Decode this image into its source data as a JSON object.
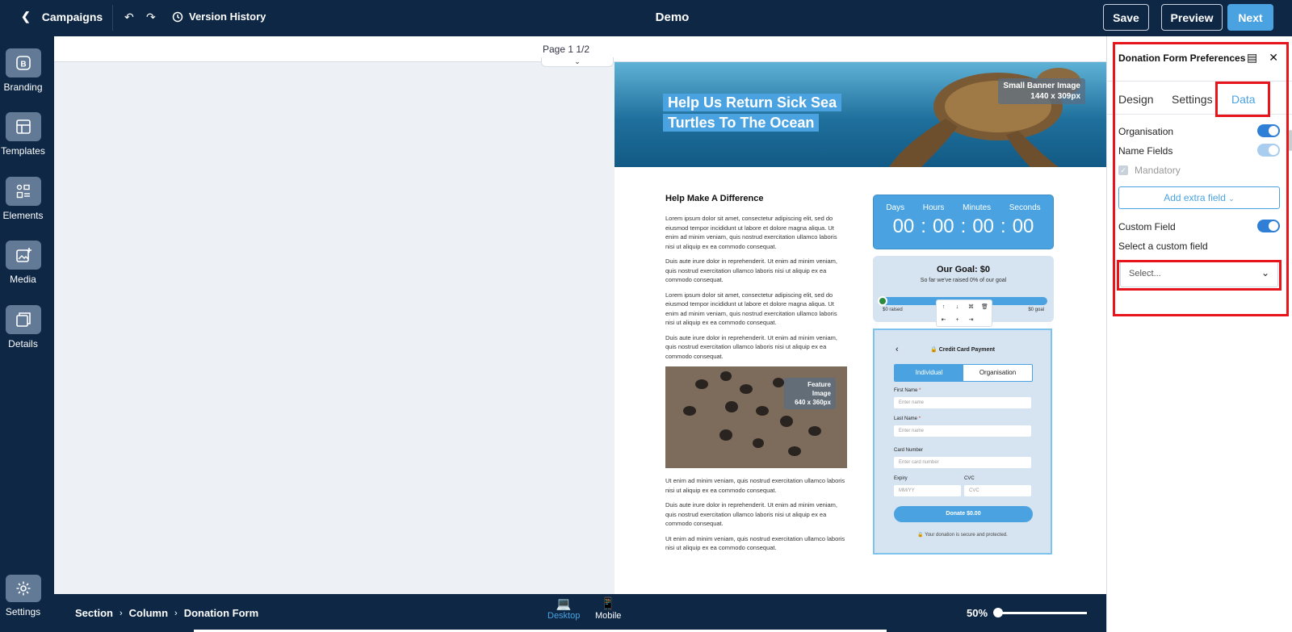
{
  "topbar": {
    "back_label": "Campaigns",
    "version_history": "Version History",
    "title": "Demo",
    "save": "Save",
    "preview": "Preview",
    "next": "Next"
  },
  "sidebar": {
    "items": [
      {
        "label": "Branding",
        "icon": "branding-icon"
      },
      {
        "label": "Templates",
        "icon": "templates-icon"
      },
      {
        "label": "Elements",
        "icon": "elements-icon"
      },
      {
        "label": "Media",
        "icon": "media-icon"
      },
      {
        "label": "Details",
        "icon": "details-icon"
      }
    ],
    "settings": "Settings"
  },
  "canvas": {
    "page_indicator": "Page 1 1/2",
    "banner_title": "Help Us Return Sick Sea Turtles To The Ocean",
    "banner_badge_line1": "Small Banner Image",
    "banner_badge_line2": "1440 x 309px",
    "heading": "Help Make A Difference",
    "paragraphs": [
      "Lorem ipsum dolor sit amet, consectetur adipiscing elit, sed do eiusmod tempor incididunt ut labore et dolore magna aliqua. Ut enim ad minim veniam, quis nostrud exercitation ullamco laboris nisi ut aliquip ex ea commodo consequat.",
      "Duis aute irure dolor in reprehenderit. Ut enim ad minim veniam, quis nostrud exercitation ullamco laboris nisi ut aliquip ex ea commodo consequat.",
      "Lorem ipsum dolor sit amet, consectetur adipiscing elit, sed do eiusmod tempor incididunt ut labore et dolore magna aliqua. Ut enim ad minim veniam, quis nostrud exercitation ullamco laboris nisi ut aliquip ex ea commodo consequat.",
      "Duis aute irure dolor in reprehenderit. Ut enim ad minim veniam, quis nostrud exercitation ullamco laboris nisi ut aliquip ex ea commodo consequat."
    ],
    "feature_badge_line1": "Feature Image",
    "feature_badge_line2": "640 x 360px",
    "paragraphs_after": [
      "Ut enim ad minim veniam, quis nostrud exercitation ullamco laboris nisi ut aliquip ex ea commodo consequat.",
      "Duis aute irure dolor in reprehenderit. Ut enim ad minim veniam, quis nostrud exercitation ullamco laboris nisi ut aliquip ex ea commodo consequat.",
      "Ut enim ad minim veniam, quis nostrud exercitation ullamco laboris nisi ut aliquip ex ea commodo consequat."
    ],
    "countdown": {
      "labels": [
        "Days",
        "Hours",
        "Minutes",
        "Seconds"
      ],
      "values": [
        "00",
        "00",
        "00",
        "00"
      ]
    },
    "goal": {
      "title": "Our Goal: $0",
      "subtitle": "So far we've raised 0% of our goal",
      "raised": "$0 raised",
      "goal": "$0 goal"
    },
    "payment": {
      "header": "Credit Card Payment",
      "tab_individual": "Individual",
      "tab_organisation": "Organisation",
      "first_name_label": "First Name",
      "first_name_placeholder": "Enter name",
      "last_name_label": "Last Name",
      "last_name_placeholder": "Enter name",
      "card_label": "Card Number",
      "card_placeholder": "Enter card number",
      "expiry_label": "Expiry",
      "expiry_placeholder": "MM/YY",
      "cvc_label": "CVC",
      "cvc_placeholder": "CVC",
      "donate": "Donate $0.00",
      "secure": "Your donation is secure and protected."
    }
  },
  "panel": {
    "title": "Donation Form Preferences",
    "tabs": [
      "Design",
      "Settings",
      "Data"
    ],
    "active_tab": "Data",
    "organisation": "Organisation",
    "name_fields": "Name Fields",
    "mandatory": "Mandatory",
    "add_extra": "Add extra field",
    "custom_field": "Custom Field",
    "select_custom": "Select a custom field",
    "select_placeholder": "Select..."
  },
  "bottombar": {
    "crumbs": [
      "Section",
      "Column",
      "Donation Form"
    ],
    "desktop": "Desktop",
    "mobile": "Mobile",
    "zoom": "50%"
  },
  "colors": {
    "navy": "#0d2745",
    "accent": "#4aa3e0",
    "highlight": "#e8141c"
  }
}
